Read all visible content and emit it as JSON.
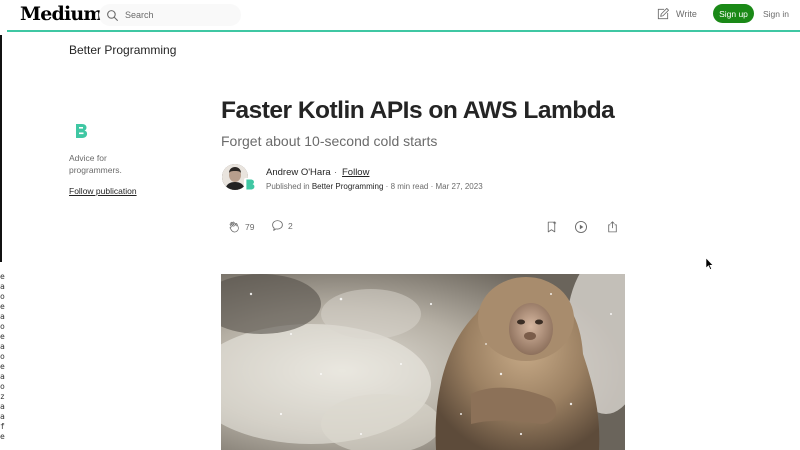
{
  "nav": {
    "logo": "Medium",
    "search_placeholder": "Search",
    "write_label": "Write",
    "signup_label": "Sign up",
    "signin_label": "Sign in",
    "accent_color": "#1a8917",
    "underline_color": "#3fc7a3"
  },
  "left_strip": {
    "glyphs": [
      "e",
      "a",
      "o",
      "e",
      "a",
      "o",
      "e",
      "a",
      "o",
      "e",
      "a",
      "o",
      "z",
      "a",
      "a",
      "f",
      "e"
    ]
  },
  "publication": {
    "name": "Better Programming",
    "description": "Advice for programmers.",
    "follow_label": "Follow publication"
  },
  "article": {
    "title": "Faster Kotlin APIs on AWS Lambda",
    "subtitle": "Forget about 10-second cold starts",
    "author": "Andrew O'Hara",
    "separator": "·",
    "follow_label": "Follow",
    "published_prefix": "Published in",
    "publication": "Better Programming",
    "read_time": "8 min read",
    "date": "Mar 27, 2023",
    "claps": "79",
    "responses": "2"
  },
  "icons": {
    "search": "search-icon",
    "write": "write-icon",
    "clap": "clap-icon",
    "response": "response-icon",
    "bookmark": "bookmark-icon",
    "listen": "play-icon",
    "share": "share-icon",
    "pub_logo": "better-programming-logo"
  }
}
